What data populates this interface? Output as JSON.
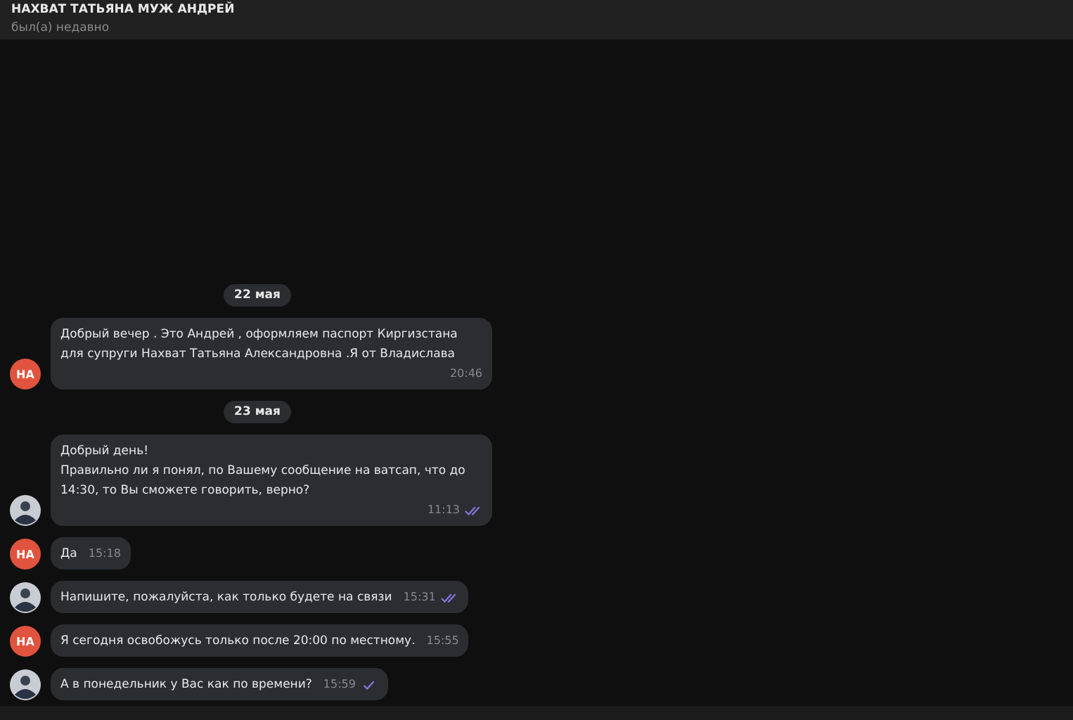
{
  "header": {
    "title": "НАХВАТ ТАТЬЯНА МУЖ АНДРЕЙ",
    "status": "был(а) недавно"
  },
  "messages": [
    {
      "kind": "date",
      "text": "22 мая"
    },
    {
      "kind": "incoming",
      "avatar": "НА",
      "text": "Добрый вечер . Это Андрей , оформляем паспорт Киргизстана для супруги Нахват Татьяна Александровна .Я от Владислава",
      "time": "20:46"
    },
    {
      "kind": "date",
      "text": "23 мая"
    },
    {
      "kind": "outgoing",
      "text": "Добрый день!\nПравильно ли я понял, по Вашему сообщение на ватсап, что до 14:30, то Вы сможете говорить, верно?",
      "time": "11:13",
      "read": true
    },
    {
      "kind": "incoming",
      "avatar": "НА",
      "text": "Да",
      "time": "15:18"
    },
    {
      "kind": "outgoing",
      "text": "Напишите, пожалуйста, как только будете на связи",
      "time": "15:31",
      "read": true
    },
    {
      "kind": "incoming",
      "avatar": "НА",
      "text": "Я сегодня освобожусь только после 20:00 по местному.",
      "time": "15:55"
    },
    {
      "kind": "outgoing",
      "text": "А в понедельник у Вас как по времени?",
      "time": "15:59",
      "read": false
    }
  ]
}
